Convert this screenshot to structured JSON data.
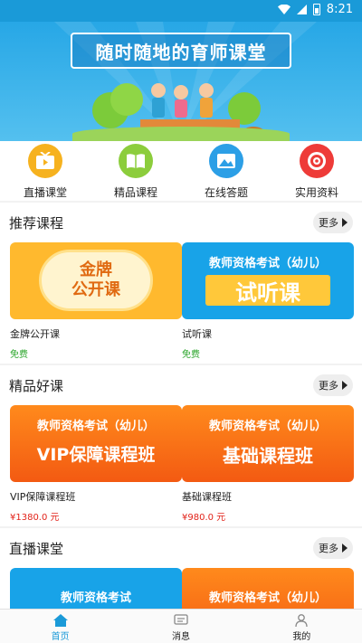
{
  "status": {
    "time": "8:21"
  },
  "banner": {
    "title": "随时随地的育师课堂"
  },
  "quick_nav": [
    {
      "label": "直播课堂",
      "icon": "tv-icon",
      "color": "#f6b21f"
    },
    {
      "label": "精品课程",
      "icon": "book-icon",
      "color": "#8ccd3c"
    },
    {
      "label": "在线答题",
      "icon": "mountain-icon",
      "color": "#2c9fe6"
    },
    {
      "label": "实用资料",
      "icon": "target-icon",
      "color": "#ee3b38"
    }
  ],
  "sections": {
    "recommended": {
      "title": "推荐课程",
      "more": "更多",
      "cards": [
        {
          "name": "金牌公开课",
          "price": "免费",
          "thumb_l1": "金牌",
          "thumb_l2": "公开课"
        },
        {
          "name": "试听课",
          "price": "免费",
          "thumb_l1": "教师资格考试（幼儿）",
          "thumb_l2": "试听课"
        }
      ]
    },
    "premium": {
      "title": "精品好课",
      "more": "更多",
      "cards": [
        {
          "name": "VIP保障课程班",
          "price": "¥1380.0 元",
          "thumb_l1": "教师资格考试（幼儿）",
          "thumb_l2": "VIP保障课程班"
        },
        {
          "name": "基础课程班",
          "price": "¥980.0 元",
          "thumb_l1": "教师资格考试（幼儿）",
          "thumb_l2": "基础课程班"
        }
      ]
    },
    "live": {
      "title": "直播课堂",
      "more": "更多",
      "cards": [
        {
          "thumb_l1": "教师资格考试"
        },
        {
          "thumb_l1": "教师资格考试（幼儿）"
        }
      ]
    }
  },
  "tabbar": [
    {
      "label": "首页",
      "icon": "home-icon",
      "active": true
    },
    {
      "label": "消息",
      "icon": "message-icon",
      "active": false
    },
    {
      "label": "我的",
      "icon": "user-icon",
      "active": false
    }
  ],
  "colors": {
    "accent": "#1a9ad8",
    "free": "#2aa52a",
    "price": "#e2231a"
  }
}
